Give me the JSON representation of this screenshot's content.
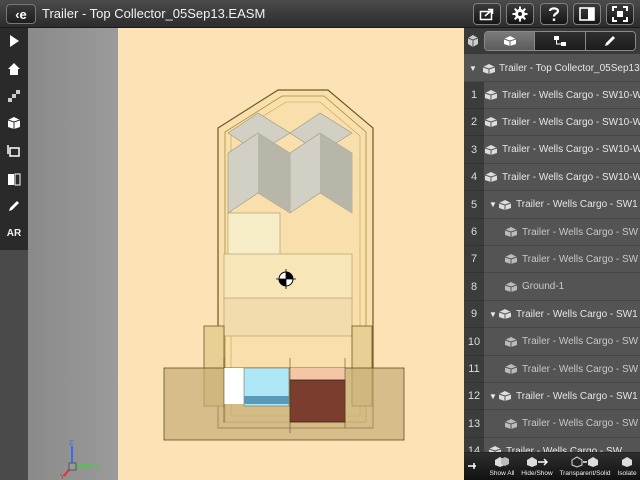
{
  "header": {
    "app_button_label": "‹e",
    "title": "Trailer - Top Collector_05Sep13.EASM",
    "buttons": [
      {
        "name": "share-button",
        "icon": "share-icon"
      },
      {
        "name": "settings-button",
        "icon": "gear-icon"
      },
      {
        "name": "help-button",
        "icon": "help-icon"
      },
      {
        "name": "layout-button",
        "icon": "panel-layout-icon"
      },
      {
        "name": "fullscreen-button",
        "icon": "fullscreen-icon"
      }
    ]
  },
  "left_toolbar": {
    "tools": [
      {
        "name": "play-tool",
        "icon": "play-icon"
      },
      {
        "name": "home-tool",
        "icon": "home-icon"
      },
      {
        "name": "explode-tool",
        "icon": "explode-icon"
      },
      {
        "name": "views-tool",
        "icon": "views-icon"
      },
      {
        "name": "measure-tool",
        "icon": "measure-icon"
      },
      {
        "name": "section-tool",
        "icon": "section-icon"
      },
      {
        "name": "markup-tool",
        "icon": "pencil-icon"
      }
    ],
    "ar_label": "AR"
  },
  "panel": {
    "tabs": [
      {
        "name": "tab-components",
        "icon": "components-icon",
        "active": true
      },
      {
        "name": "tab-configurations",
        "icon": "hierarchy-icon",
        "active": false
      },
      {
        "name": "tab-markup",
        "icon": "pencil-icon",
        "active": false
      }
    ],
    "root": "Trailer - Top Collector_05Sep13",
    "rows": [
      {
        "num": "1",
        "label": "Trailer - Wells Cargo - SW10-W",
        "indent": 0,
        "caret": false
      },
      {
        "num": "2",
        "label": "Trailer - Wells Cargo - SW10-W",
        "indent": 0,
        "caret": false
      },
      {
        "num": "3",
        "label": "Trailer - Wells Cargo - SW10-W",
        "indent": 0,
        "caret": false
      },
      {
        "num": "4",
        "label": "Trailer - Wells Cargo - SW10-W",
        "indent": 0,
        "caret": false
      },
      {
        "num": "5",
        "label": "Trailer - Wells Cargo - SW1",
        "indent": 0,
        "caret": true
      },
      {
        "num": "6",
        "label": "Trailer - Wells Cargo - SW",
        "indent": 1,
        "caret": false
      },
      {
        "num": "7",
        "label": "Trailer - Wells Cargo - SW",
        "indent": 1,
        "caret": false
      },
      {
        "num": "8",
        "label": "Ground-1",
        "indent": 1,
        "caret": false
      },
      {
        "num": "9",
        "label": "Trailer - Wells Cargo - SW1",
        "indent": 0,
        "caret": true
      },
      {
        "num": "10",
        "label": "Trailer - Wells Cargo - SW",
        "indent": 1,
        "caret": false
      },
      {
        "num": "11",
        "label": "Trailer - Wells Cargo - SW",
        "indent": 1,
        "caret": false
      },
      {
        "num": "12",
        "label": "Trailer - Wells Cargo - SW1",
        "indent": 0,
        "caret": true
      },
      {
        "num": "13",
        "label": "Trailer - Wells Cargo - SW",
        "indent": 1,
        "caret": false
      },
      {
        "num": "14",
        "label": "Trailer - Wells Cargo - SW",
        "indent": 0,
        "caret": false
      }
    ]
  },
  "bottom_toolbar": {
    "buttons": [
      {
        "name": "show-all-button",
        "label": "Show All"
      },
      {
        "name": "hide-show-button",
        "label": "Hide/Show"
      },
      {
        "name": "transparent-solid-button",
        "label": "Transparent/Solid"
      },
      {
        "name": "isolate-button",
        "label": "Isolate"
      }
    ]
  },
  "triad": {
    "x": "X",
    "y": "Y",
    "z": "Z"
  },
  "colors": {
    "sheet": "#fce3b6",
    "topbar": "#2c2c2c",
    "panel": "#545454",
    "box_blue": "#aee8f8",
    "box_brown": "#7a3d2e"
  }
}
